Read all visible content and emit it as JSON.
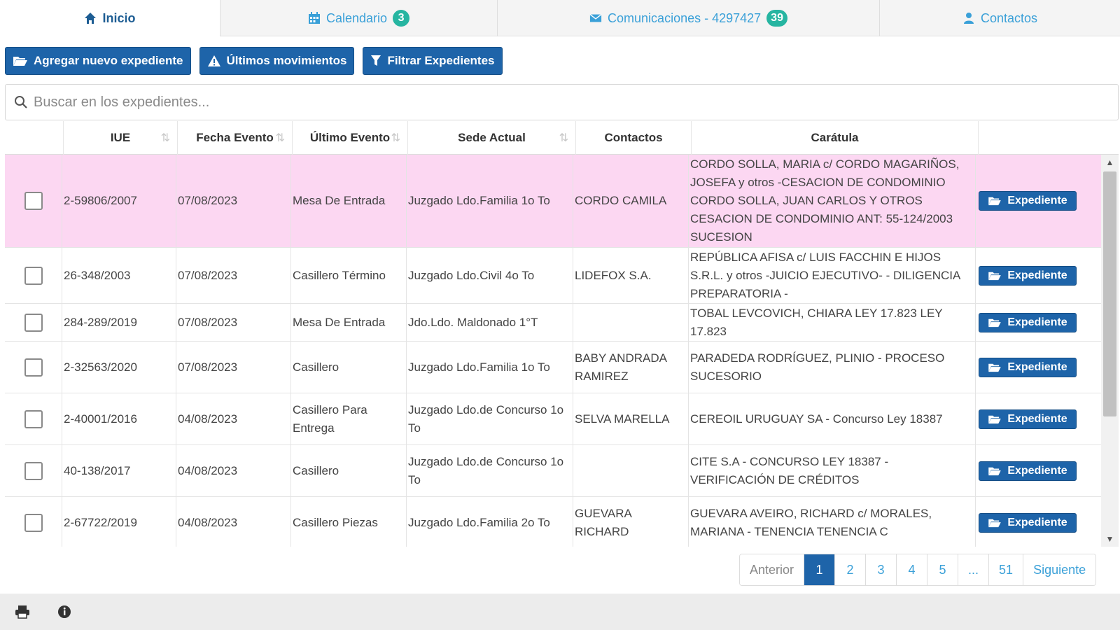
{
  "tabs": [
    {
      "label": "Inicio",
      "icon": "home-icon",
      "active": true,
      "badge": ""
    },
    {
      "label": "Calendario",
      "icon": "calendar-icon",
      "active": false,
      "badge": "3"
    },
    {
      "label": "Comunicaciones - 4297427",
      "icon": "envelope-icon",
      "active": false,
      "badge": "39"
    },
    {
      "label": "Contactos",
      "icon": "user-icon",
      "active": false,
      "badge": ""
    }
  ],
  "toolbar": {
    "add_label": "Agregar nuevo expediente",
    "last_label": "Últimos movimientos",
    "filter_label": "Filtrar Expedientes"
  },
  "search": {
    "placeholder": "Buscar en los expedientes...",
    "value": ""
  },
  "table": {
    "headers": [
      "",
      "IUE",
      "Fecha Evento",
      "Último Evento",
      "Sede Actual",
      "Contactos",
      "Carátula",
      ""
    ],
    "button_label": "Expediente",
    "rows": [
      {
        "iue": "2-59806/2007",
        "fecha": "07/08/2023",
        "evento": "Mesa De Entrada",
        "sede": "Juzgado Ldo.Familia 1o To",
        "contactos": "CORDO CAMILA",
        "caratula": "CORDO SOLLA, MARIA c/ CORDO MAGARIÑOS, JOSEFA y otros -CESACION DE CONDOMINIO CORDO SOLLA, JUAN CARLOS Y OTROS CESACION DE CONDOMINIO ANT: 55-124/2003 SUCESION",
        "selected": true
      },
      {
        "iue": "26-348/2003",
        "fecha": "07/08/2023",
        "evento": "Casillero Término",
        "sede": "Juzgado Ldo.Civil 4o To",
        "contactos": "LIDEFOX S.A.",
        "caratula": "REPÚBLICA AFISA c/ LUIS FACCHIN E HIJOS S.R.L. y otros -JUICIO EJECUTIVO- - DILIGENCIA PREPARATORIA -",
        "selected": false
      },
      {
        "iue": "284-289/2019",
        "fecha": "07/08/2023",
        "evento": "Mesa De Entrada",
        "sede": "Jdo.Ldo. Maldonado 1°T",
        "contactos": "",
        "caratula": "TOBAL LEVCOVICH, CHIARA LEY 17.823 LEY 17.823",
        "selected": false
      },
      {
        "iue": "2-32563/2020",
        "fecha": "07/08/2023",
        "evento": "Casillero",
        "sede": "Juzgado Ldo.Familia 1o To",
        "contactos": "BABY ANDRADA RAMIREZ",
        "caratula": "PARADEDA RODRÍGUEZ, PLINIO - PROCESO SUCESORIO",
        "selected": false
      },
      {
        "iue": "2-40001/2016",
        "fecha": "04/08/2023",
        "evento": "Casillero Para Entrega",
        "sede": "Juzgado Ldo.de Concurso 1o To",
        "contactos": "SELVA MARELLA",
        "caratula": "CEREOIL URUGUAY SA - Concurso Ley 18387",
        "selected": false
      },
      {
        "iue": "40-138/2017",
        "fecha": "04/08/2023",
        "evento": "Casillero",
        "sede": "Juzgado Ldo.de Concurso 1o To",
        "contactos": "",
        "caratula": "CITE S.A - CONCURSO LEY 18387 - VERIFICACIÓN DE CRÉDITOS",
        "selected": false
      },
      {
        "iue": "2-67722/2019",
        "fecha": "04/08/2023",
        "evento": "Casillero Piezas",
        "sede": "Juzgado Ldo.Familia 2o To",
        "contactos": "GUEVARA RICHARD",
        "caratula": "GUEVARA AVEIRO, RICHARD c/ MORALES, MARIANA - TENENCIA TENENCIA C",
        "selected": false
      }
    ]
  },
  "pagination": {
    "prev": "Anterior",
    "pages": [
      "1",
      "2",
      "3",
      "4",
      "5",
      "...",
      "51"
    ],
    "next": "Siguiente",
    "current": "1"
  },
  "footer": {
    "icons": [
      "print-icon",
      "info-icon"
    ]
  },
  "colors": {
    "primary": "#1e64a9",
    "link": "#3aa0d8",
    "badge": "#26b5a1",
    "selected_row": "#fcd7f2"
  }
}
